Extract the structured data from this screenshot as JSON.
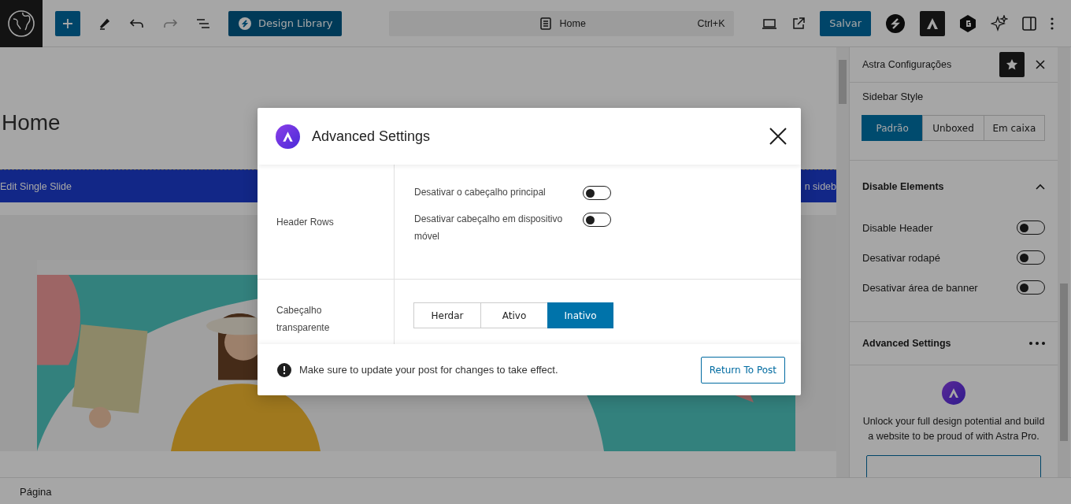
{
  "toolbar": {
    "library_label": "Design Library",
    "command": {
      "title": "Home",
      "shortcut": "Ctrl+K"
    },
    "save": "Salvar"
  },
  "canvas": {
    "title": "Home",
    "block_bar": {
      "label": "Edit Single Slide",
      "right_text": "n sideb"
    }
  },
  "sidebar": {
    "title": "Astra Configurações",
    "sidebar_style": {
      "label": "Sidebar Style",
      "options": [
        {
          "label": "Padrão",
          "selected": true
        },
        {
          "label": "Unboxed",
          "selected": false
        },
        {
          "label": "Em caixa",
          "selected": false
        }
      ]
    },
    "disable_elements": {
      "title": "Disable Elements",
      "expanded": true,
      "toggles": [
        {
          "label": "Disable Header",
          "on": false
        },
        {
          "label": "Desativar rodapé",
          "on": false
        },
        {
          "label": "Desativar área de banner",
          "on": false
        }
      ]
    },
    "advanced_settings": {
      "title": "Advanced Settings"
    },
    "promo": {
      "text": "Unlock your full design potential and build a website to be proud of with Astra Pro."
    }
  },
  "status_bar": {
    "breadcrumb": "Página"
  },
  "modal": {
    "title": "Advanced Settings",
    "rows": [
      {
        "label": "Header Rows",
        "kind": "toggles",
        "toggles": [
          {
            "label": "Desativar o cabeçalho principal",
            "on": false
          },
          {
            "label": "Desativar cabeçalho em dispositivo móvel",
            "on": false
          }
        ]
      },
      {
        "label": "Cabeçalho transparente",
        "kind": "segmented",
        "options": [
          {
            "label": "Herdar",
            "selected": false
          },
          {
            "label": "Ativo",
            "selected": false
          },
          {
            "label": "Inativo",
            "selected": true
          }
        ]
      }
    ],
    "notice": "Make sure to update your post for changes to take effect.",
    "button": "Return To Post"
  }
}
